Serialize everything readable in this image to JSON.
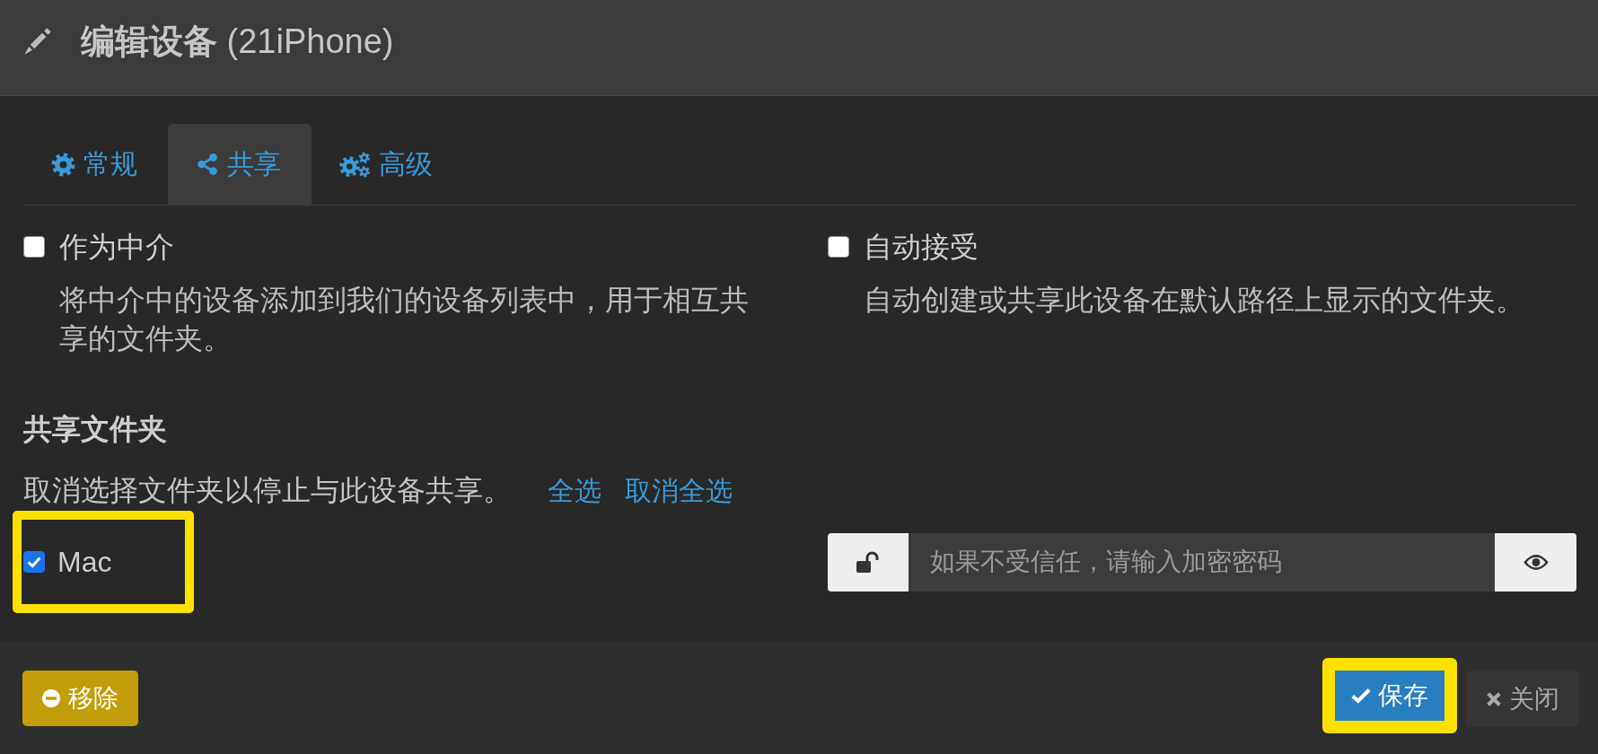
{
  "dialog": {
    "title": "**编辑设备** (21iPhone)"
  },
  "tabs": [
    {
      "label": "常规",
      "selected": false
    },
    {
      "label": "共享",
      "selected": true
    },
    {
      "label": "高级",
      "selected": false
    }
  ],
  "options": [
    {
      "label": "作为中介",
      "checked": false,
      "description": "将中介中的设备添加到我们的设备列表中，用于相互共享的文件夹。"
    },
    {
      "label": "自动接受",
      "checked": false,
      "description": "自动创建或共享此设备在默认路径上显示的文件夹。"
    }
  ],
  "shared_folders": {
    "heading": "共享文件夹",
    "hint": "取消选择文件夹以停止与此设备共享。",
    "select_all": "全选",
    "deselect_all": "取消全选",
    "folders": [
      {
        "label": "Mac",
        "checked": true,
        "highlighted": true
      }
    ]
  },
  "password": {
    "placeholder": "如果不受信任，请输入加密密码"
  },
  "footer": {
    "left_buttons": [
      {
        "label": "移除",
        "kind": "danger",
        "highlighted": false
      }
    ],
    "right_buttons": [
      {
        "label": "保存",
        "kind": "primary",
        "highlighted": true
      },
      {
        "label": "关闭",
        "kind": "default",
        "highlighted": false
      }
    ]
  }
}
